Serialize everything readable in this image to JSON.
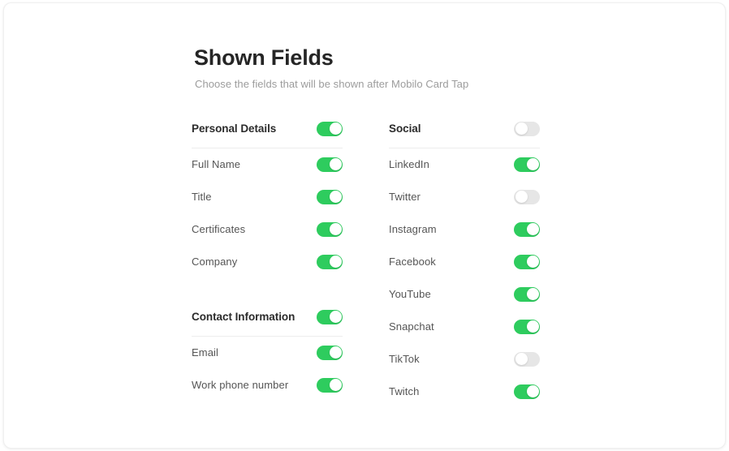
{
  "header": {
    "title": "Shown Fields",
    "subtitle": "Choose the fields that will be shown after Mobilo Card Tap"
  },
  "colors": {
    "toggle_on": "#2ecc5e",
    "toggle_off": "#e6e6e6",
    "title": "#252525",
    "subtitle": "#9c9c9c",
    "label": "#555555",
    "divider": "#ededed"
  },
  "columns": [
    {
      "name": "left",
      "groups": [
        {
          "header": {
            "label": "Personal Details",
            "enabled": true
          },
          "fields": [
            {
              "label": "Full Name",
              "enabled": true
            },
            {
              "label": "Title",
              "enabled": true
            },
            {
              "label": "Certificates",
              "enabled": true
            },
            {
              "label": "Company",
              "enabled": true
            }
          ]
        },
        {
          "header": {
            "label": "Contact Information",
            "enabled": true
          },
          "fields": [
            {
              "label": "Email",
              "enabled": true
            },
            {
              "label": "Work phone number",
              "enabled": true
            }
          ]
        }
      ]
    },
    {
      "name": "right",
      "groups": [
        {
          "header": {
            "label": "Social",
            "enabled": false
          },
          "fields": [
            {
              "label": "LinkedIn",
              "enabled": true
            },
            {
              "label": "Twitter",
              "enabled": false
            },
            {
              "label": "Instagram",
              "enabled": true
            },
            {
              "label": "Facebook",
              "enabled": true
            },
            {
              "label": "YouTube",
              "enabled": true
            },
            {
              "label": "Snapchat",
              "enabled": true
            },
            {
              "label": "TikTok",
              "enabled": false
            },
            {
              "label": "Twitch",
              "enabled": true
            }
          ]
        }
      ]
    }
  ]
}
